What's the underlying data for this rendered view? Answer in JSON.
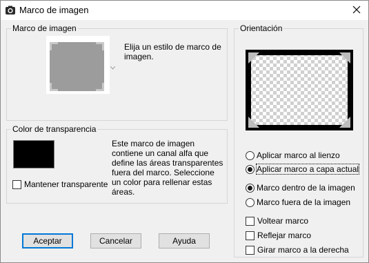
{
  "window": {
    "title": "Marco de imagen",
    "icons": {
      "app": "camera-icon",
      "close": "close-icon"
    }
  },
  "frame_group": {
    "label": "Marco de imagen",
    "description": "Elija un estilo de marco de imagen.",
    "icons": {
      "dropdown": "chevron-down-icon"
    }
  },
  "transparency_group": {
    "label": "Color de transparencia",
    "swatch_color": "#000000",
    "keep_transparent_label": "Mantener transparente",
    "description": "Este marco de imagen contiene un canal alfa que define las áreas transparentes fuera del marco. Seleccione un color para rellenar estas áreas."
  },
  "orientation_group": {
    "label": "Orientación",
    "apply_canvas_label": "Aplicar marco al lienzo",
    "apply_layer_label": "Aplicar marco a capa actual",
    "inside_label": "Marco dentro de la imagen",
    "outside_label": "Marco fuera de la imagen",
    "flip_label": "Voltear marco",
    "mirror_label": "Reflejar marco",
    "rotate_label": "Girar marco a la derecha"
  },
  "buttons": {
    "ok": "Aceptar",
    "cancel": "Cancelar",
    "help": "Ayuda"
  },
  "colors": {
    "accent": "#0078d7",
    "dialog_bg": "#f0f0f0"
  }
}
